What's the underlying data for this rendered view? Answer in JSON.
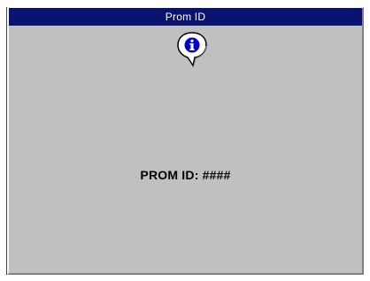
{
  "window": {
    "title": "Prom ID"
  },
  "icon": {
    "name": "info-icon",
    "color": "#0000c8"
  },
  "message": {
    "text": "PROM ID: ####"
  },
  "colors": {
    "titlebar": "#0a1470",
    "dialog_bg": "#c0c0c0"
  }
}
